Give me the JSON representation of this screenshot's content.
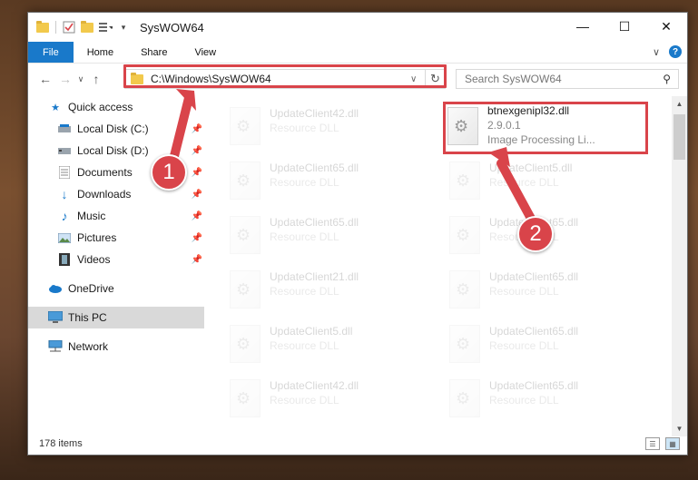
{
  "window": {
    "title": "SysWOW64"
  },
  "ribbon": {
    "tabs": [
      "File",
      "Home",
      "Share",
      "View"
    ]
  },
  "address": {
    "path": "C:\\Windows\\SysWOW64"
  },
  "search": {
    "placeholder": "Search SysWOW64"
  },
  "sidebar": {
    "items": [
      {
        "label": "Quick access",
        "icon": "star-icon"
      },
      {
        "label": "Local Disk (C:)",
        "icon": "drive-icon"
      },
      {
        "label": "Local Disk (D:)",
        "icon": "drive-icon"
      },
      {
        "label": "Documents",
        "icon": "documents-icon"
      },
      {
        "label": "Downloads",
        "icon": "download-icon"
      },
      {
        "label": "Music",
        "icon": "music-icon"
      },
      {
        "label": "Pictures",
        "icon": "pictures-icon"
      },
      {
        "label": "Videos",
        "icon": "videos-icon"
      },
      {
        "label": "OneDrive",
        "icon": "cloud-icon"
      },
      {
        "label": "This PC",
        "icon": "computer-icon"
      },
      {
        "label": "Network",
        "icon": "network-icon"
      }
    ]
  },
  "files": {
    "left": [
      {
        "name": "UpdateClient42.dll",
        "desc": "Resource DLL"
      },
      {
        "name": "UpdateClient65.dll",
        "desc": "Resource DLL"
      },
      {
        "name": "UpdateClient65.dll",
        "desc": "Resource DLL"
      },
      {
        "name": "UpdateClient21.dll",
        "desc": "Resource DLL"
      },
      {
        "name": "UpdateClient5.dll",
        "desc": "Resource DLL"
      },
      {
        "name": "UpdateClient42.dll",
        "desc": "Resource DLL"
      }
    ],
    "right": [
      {
        "name": "btnexgenipl32.dll",
        "version": "2.9.0.1",
        "desc": "Image Processing Li..."
      },
      {
        "name": "UpdateClient5.dll",
        "desc": "Resource DLL"
      },
      {
        "name": "UpdateClient65.dll",
        "desc": "Resource DLL"
      },
      {
        "name": "UpdateClient65.dll",
        "desc": "Resource DLL"
      },
      {
        "name": "UpdateClient65.dll",
        "desc": "Resource DLL"
      },
      {
        "name": "UpdateClient65.dll",
        "desc": "Resource DLL"
      }
    ]
  },
  "status": {
    "item_count": "178 items"
  },
  "annotations": {
    "step1": "1",
    "step2": "2",
    "color": "#d9444a"
  }
}
